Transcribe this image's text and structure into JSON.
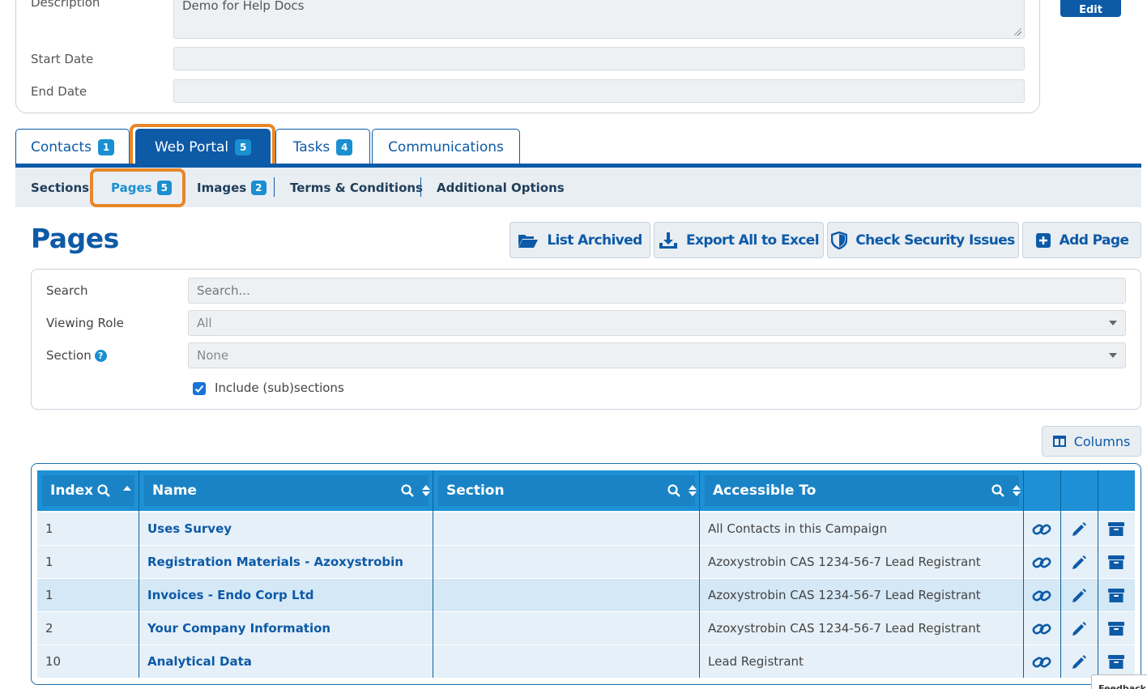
{
  "details": {
    "description_label": "Description",
    "description_value": "Demo for Help Docs",
    "start_date_label": "Start Date",
    "start_date_value": "",
    "end_date_label": "End Date",
    "end_date_value": "",
    "edit_label": "Edit"
  },
  "tabs": [
    {
      "label": "Contacts",
      "badge": "1"
    },
    {
      "label": "Web Portal",
      "badge": "5"
    },
    {
      "label": "Tasks",
      "badge": "4"
    },
    {
      "label": "Communications",
      "badge": ""
    }
  ],
  "subnav": [
    {
      "label": "Sections",
      "badge": ""
    },
    {
      "label": "Pages",
      "badge": "5"
    },
    {
      "label": "Images",
      "badge": "2"
    },
    {
      "label": "Terms & Conditions",
      "badge": ""
    },
    {
      "label": "Additional Options",
      "badge": ""
    }
  ],
  "page": {
    "title": "Pages",
    "toolbar": {
      "list_archived": "List Archived",
      "export_excel": "Export All to Excel",
      "check_security": "Check Security Issues",
      "add_page": "Add Page"
    }
  },
  "filters": {
    "search_label": "Search",
    "search_placeholder": "Search...",
    "role_label": "Viewing Role",
    "role_value": "All",
    "section_label": "Section",
    "section_value": "None",
    "include_label": "Include (sub)sections",
    "include_checked": true
  },
  "columns_label": "Columns",
  "table": {
    "headers": [
      "Index",
      "Name",
      "Section",
      "Accessible To"
    ],
    "rows": [
      {
        "index": "1",
        "name": "Uses Survey",
        "section": "",
        "accessible": "All Contacts in this Campaign"
      },
      {
        "index": "1",
        "name": "Registration Materials - Azoxystrobin",
        "section": "",
        "accessible": "Azoxystrobin CAS 1234-56-7 Lead Registrant"
      },
      {
        "index": "1",
        "name": "Invoices - Endo Corp Ltd",
        "section": "",
        "accessible": "Azoxystrobin CAS 1234-56-7 Lead Registrant"
      },
      {
        "index": "2",
        "name": "Your Company Information",
        "section": "",
        "accessible": "Azoxystrobin CAS 1234-56-7 Lead Registrant"
      },
      {
        "index": "10",
        "name": "Analytical Data",
        "section": "",
        "accessible": "Lead Registrant"
      }
    ]
  },
  "feedback_label": "Feedback",
  "colors": {
    "primary": "#0d5aa7",
    "accent": "#1a8fd1",
    "header": "#1e90d6",
    "highlight": "#e8862a"
  }
}
